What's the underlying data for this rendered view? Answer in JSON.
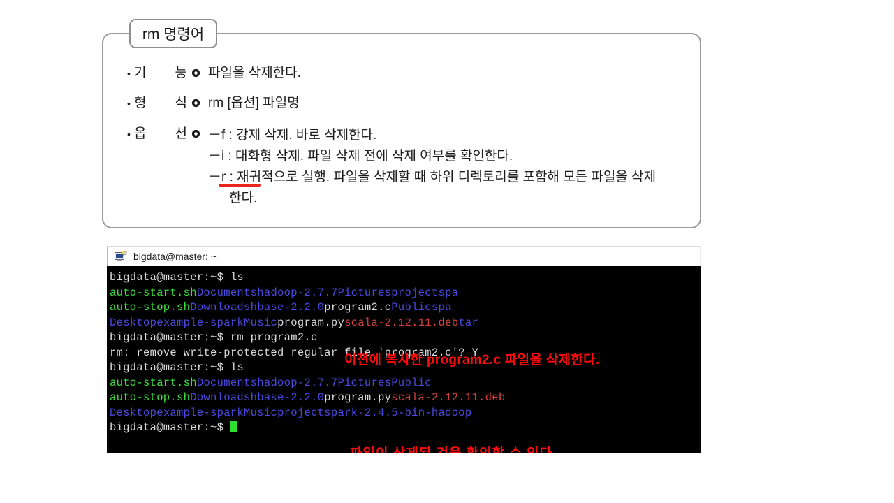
{
  "slide": {
    "title": "rm 명령어",
    "bullets": [
      {
        "marker": "•",
        "label_left": "기",
        "label_right": "능",
        "ring_icon": "ring-icon",
        "body": "파일을 삭제한다."
      },
      {
        "marker": "•",
        "label_left": "형",
        "label_right": "식",
        "ring_icon": "ring-icon",
        "body": "rm [옵션] 파일명"
      },
      {
        "marker": "•",
        "label_left": "옵",
        "label_right": "션",
        "ring_icon": "ring-icon",
        "options": [
          "－f : 강제 삭제. 바로 삭제한다.",
          "－i : 대화형 삭제. 파일 삭제 전에 삭제 여부를 확인한다.",
          "－r : 재귀적으로 실행. 파일을 삭제할 때 하위 디렉토리를 포함해 모든 파일을 삭제",
          "한다."
        ]
      }
    ],
    "underline_color": "#e8261c"
  },
  "terminal": {
    "title": "bigdata@master: ~",
    "title_icon": "terminal-window-icon",
    "prompt": "bigdata@master:~$",
    "cursor": "block-cursor",
    "colors": {
      "background": "#000000",
      "text": "#d9d9d9",
      "executable": "#3ae03a",
      "directory": "#4a4ae0",
      "archive": "#d64040",
      "annotation": "#fb0b0b",
      "cursor": "#2ee02e"
    },
    "lines": [
      {
        "type": "prompt",
        "prompt": "bigdata@master:~$",
        "command": " ls"
      },
      {
        "type": "listing",
        "cells": [
          {
            "text": "auto-start.sh",
            "color": "green"
          },
          {
            "text": "Documents",
            "color": "blue"
          },
          {
            "text": "hadoop-2.7.7",
            "color": "blue"
          },
          {
            "text": "Pictures",
            "color": "blue"
          },
          {
            "text": "project",
            "color": "blue"
          },
          {
            "text": "spa",
            "color": "blue"
          }
        ]
      },
      {
        "type": "listing",
        "cells": [
          {
            "text": "auto-stop.sh",
            "color": "green"
          },
          {
            "text": "Downloads",
            "color": "blue"
          },
          {
            "text": "hbase-2.2.0",
            "color": "blue"
          },
          {
            "text": "program2.c",
            "color": "white"
          },
          {
            "text": "Public",
            "color": "blue"
          },
          {
            "text": "spa",
            "color": "blue"
          }
        ]
      },
      {
        "type": "listing",
        "cells": [
          {
            "text": "Desktop",
            "color": "blue"
          },
          {
            "text": "example-spark",
            "color": "blue"
          },
          {
            "text": "Music",
            "color": "blue"
          },
          {
            "text": "program.py",
            "color": "white"
          },
          {
            "text": "scala-2.12.11.deb",
            "color": "red"
          },
          {
            "text": "tar",
            "color": "blue"
          }
        ]
      },
      {
        "type": "prompt",
        "prompt": "bigdata@master:~$",
        "command": " rm program2.c"
      },
      {
        "type": "output",
        "text": "rm: remove write-protected regular file 'program2.c'? Y"
      },
      {
        "type": "prompt",
        "prompt": "bigdata@master:~$",
        "command": " ls"
      },
      {
        "type": "listing",
        "cells": [
          {
            "text": "auto-start.sh",
            "color": "green"
          },
          {
            "text": "Documents",
            "color": "blue"
          },
          {
            "text": "hadoop-2.7.7",
            "color": "blue"
          },
          {
            "text": "Pictures",
            "color": "blue"
          },
          {
            "text": "Public",
            "color": "blue"
          }
        ]
      },
      {
        "type": "listing",
        "cells": [
          {
            "text": "auto-stop.sh",
            "color": "green"
          },
          {
            "text": "Downloads",
            "color": "blue"
          },
          {
            "text": "hbase-2.2.0",
            "color": "blue"
          },
          {
            "text": "program.py",
            "color": "white"
          },
          {
            "text": "scala-2.12.11.deb",
            "color": "red"
          }
        ]
      },
      {
        "type": "listing",
        "cells": [
          {
            "text": "Desktop",
            "color": "blue"
          },
          {
            "text": "example-spark",
            "color": "blue"
          },
          {
            "text": "Music",
            "color": "blue"
          },
          {
            "text": "project",
            "color": "blue"
          },
          {
            "text": "spark-2.4.5-bin-hadoop",
            "color": "blue"
          }
        ]
      }
    ],
    "annotations": {
      "rm_note": "이전에 복사한 program2.c 파일을 삭제한다.",
      "confirm_note": "파일이 삭제된 것을 확인할 수 있다."
    }
  }
}
